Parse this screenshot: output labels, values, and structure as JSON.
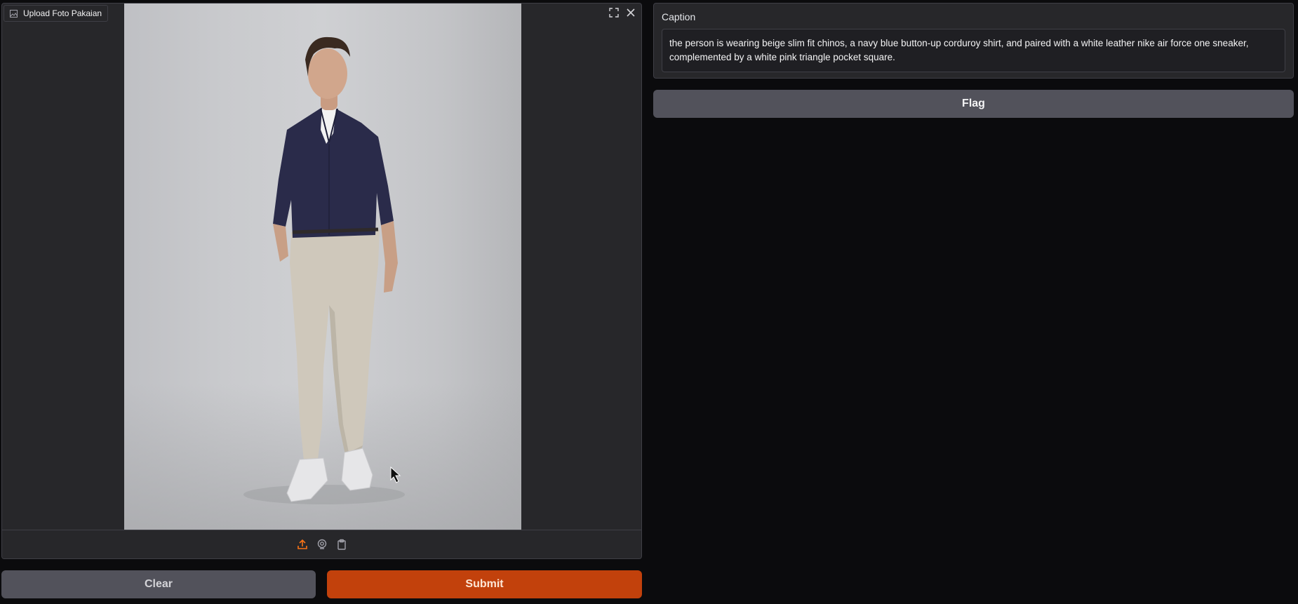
{
  "image_input": {
    "label": "Upload Foto Pakaian",
    "icons": {
      "label": "image-icon",
      "fullscreen": "fullscreen-icon",
      "close": "close-icon",
      "upload": "upload-icon",
      "webcam": "webcam-icon",
      "clipboard": "clipboard-icon"
    },
    "accent_color": "#f97316"
  },
  "buttons": {
    "clear_label": "Clear",
    "submit_label": "Submit",
    "flag_label": "Flag"
  },
  "caption": {
    "label": "Caption",
    "value": "the person is wearing beige slim fit chinos, a navy blue button-up corduroy shirt, and paired with a white leather nike air force one sneaker, complemented by a white pink triangle pocket square."
  },
  "colors": {
    "submit": "#c2410c",
    "secondary": "#52525b",
    "panel": "#27272a",
    "background": "#0b0b0d"
  }
}
